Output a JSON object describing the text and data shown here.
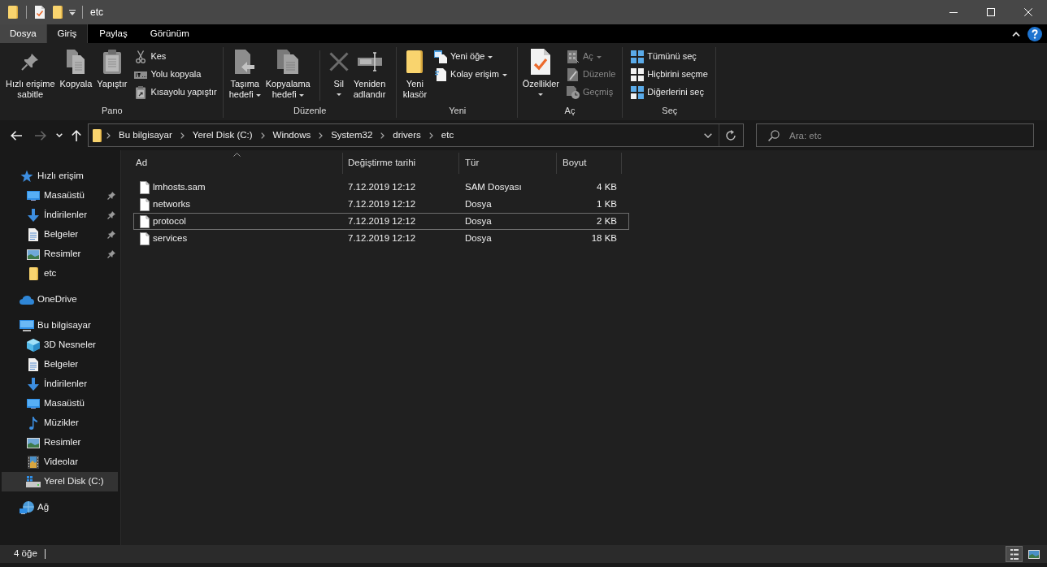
{
  "window": {
    "title": "etc"
  },
  "ribbon": {
    "tabs": [
      {
        "label": "Dosya",
        "kind": "file",
        "selected": false
      },
      {
        "label": "Giriş",
        "kind": "tab",
        "selected": true
      },
      {
        "label": "Paylaş",
        "kind": "tab",
        "selected": false
      },
      {
        "label": "Görünüm",
        "kind": "tab",
        "selected": false
      }
    ],
    "groups": [
      {
        "label": "Pano",
        "commands": [
          {
            "label": "Hızlı erişime\nsabitle",
            "kind": "large",
            "dropdown": false,
            "disabled": false
          },
          {
            "label": "Kopyala",
            "kind": "large",
            "dropdown": false,
            "disabled": false
          },
          {
            "label": "Yapıştır",
            "kind": "large",
            "dropdown": false,
            "disabled": false
          },
          {
            "label": "Kes",
            "kind": "small",
            "dropdown": false,
            "disabled": false
          },
          {
            "label": "Yolu kopyala",
            "kind": "small",
            "dropdown": false,
            "disabled": false
          },
          {
            "label": "Kısayolu yapıştır",
            "kind": "small",
            "dropdown": false,
            "disabled": false
          }
        ]
      },
      {
        "label": "Düzenle",
        "commands": [
          {
            "label": "Taşıma\nhedefi",
            "kind": "large",
            "dropdown": true,
            "disabled": false
          },
          {
            "label": "Kopyalama\nhedefi",
            "kind": "large",
            "dropdown": true,
            "disabled": false
          },
          {
            "label": "Sil",
            "kind": "large",
            "dropdown": true,
            "disabled": false
          },
          {
            "label": "Yeniden\nadlandır",
            "kind": "large",
            "dropdown": false,
            "disabled": false
          }
        ]
      },
      {
        "label": "Yeni",
        "commands": [
          {
            "label": "Yeni\nklasör",
            "kind": "large",
            "dropdown": false,
            "disabled": false
          },
          {
            "label": "Yeni öğe",
            "kind": "small",
            "dropdown": true,
            "disabled": false
          },
          {
            "label": "Kolay erişim",
            "kind": "small",
            "dropdown": true,
            "disabled": false
          }
        ]
      },
      {
        "label": "Aç",
        "commands": [
          {
            "label": "Özellikler",
            "kind": "large",
            "dropdown": true,
            "disabled": false
          },
          {
            "label": "Aç",
            "kind": "small",
            "dropdown": true,
            "disabled": true
          },
          {
            "label": "Düzenle",
            "kind": "small",
            "dropdown": false,
            "disabled": true
          },
          {
            "label": "Geçmiş",
            "kind": "small",
            "dropdown": false,
            "disabled": true
          }
        ]
      },
      {
        "label": "Seç",
        "commands": [
          {
            "label": "Tümünü seç",
            "kind": "small",
            "dropdown": false,
            "disabled": false
          },
          {
            "label": "Hiçbirini seçme",
            "kind": "small",
            "dropdown": false,
            "disabled": false
          },
          {
            "label": "Diğerlerini seç",
            "kind": "small",
            "dropdown": false,
            "disabled": false
          }
        ]
      }
    ]
  },
  "address_bar": {
    "nav_buttons": [
      {
        "kind": "back",
        "disabled": false
      },
      {
        "kind": "forward",
        "disabled": true
      },
      {
        "kind": "recent",
        "disabled": false
      },
      {
        "kind": "up",
        "disabled": false
      }
    ],
    "breadcrumbs": [
      "Bu bilgisayar",
      "Yerel Disk (C:)",
      "Windows",
      "System32",
      "drivers",
      "etc"
    ]
  },
  "search": {
    "placeholder": "Ara: etc"
  },
  "sidebar": {
    "items": [
      {
        "label": "Hızlı erişim",
        "selected": false,
        "children": [
          {
            "label": "Masaüstü",
            "pinned": true,
            "selected": false
          },
          {
            "label": "İndirilenler",
            "pinned": true,
            "selected": false
          },
          {
            "label": "Belgeler",
            "pinned": true,
            "selected": false
          },
          {
            "label": "Resimler",
            "pinned": true,
            "selected": false
          },
          {
            "label": "etc",
            "pinned": false,
            "selected": false
          }
        ]
      },
      {
        "label": "OneDrive",
        "selected": false
      },
      {
        "label": "Bu bilgisayar",
        "selected": false,
        "children": [
          {
            "label": "3D Nesneler",
            "selected": false
          },
          {
            "label": "Belgeler",
            "selected": false
          },
          {
            "label": "İndirilenler",
            "selected": false
          },
          {
            "label": "Masaüstü",
            "selected": false
          },
          {
            "label": "Müzikler",
            "selected": false
          },
          {
            "label": "Resimler",
            "selected": false
          },
          {
            "label": "Videolar",
            "selected": false
          },
          {
            "label": "Yerel Disk (C:)",
            "selected": true
          }
        ]
      },
      {
        "label": "Ağ",
        "selected": false
      }
    ]
  },
  "file_list": {
    "columns": [
      {
        "label": "Ad",
        "sorted": true
      },
      {
        "label": "Değiştirme tarihi",
        "sorted": false
      },
      {
        "label": "Tür",
        "sorted": false
      },
      {
        "label": "Boyut",
        "sorted": false
      }
    ],
    "rows": [
      {
        "cells": [
          "lmhosts.sam",
          "7.12.2019 12:12",
          "SAM Dosyası",
          "4 KB"
        ],
        "selected": false,
        "focused": false
      },
      {
        "cells": [
          "networks",
          "7.12.2019 12:12",
          "Dosya",
          "1 KB"
        ],
        "selected": false,
        "focused": false
      },
      {
        "cells": [
          "protocol",
          "7.12.2019 12:12",
          "Dosya",
          "2 KB"
        ],
        "selected": false,
        "focused": true
      },
      {
        "cells": [
          "services",
          "7.12.2019 12:12",
          "Dosya",
          "18 KB"
        ],
        "selected": false,
        "focused": false
      }
    ]
  },
  "status_bar": {
    "item_count": "4 öğe",
    "views": [
      {
        "kind": "details",
        "selected": true
      },
      {
        "kind": "large_icons",
        "selected": false
      }
    ]
  }
}
